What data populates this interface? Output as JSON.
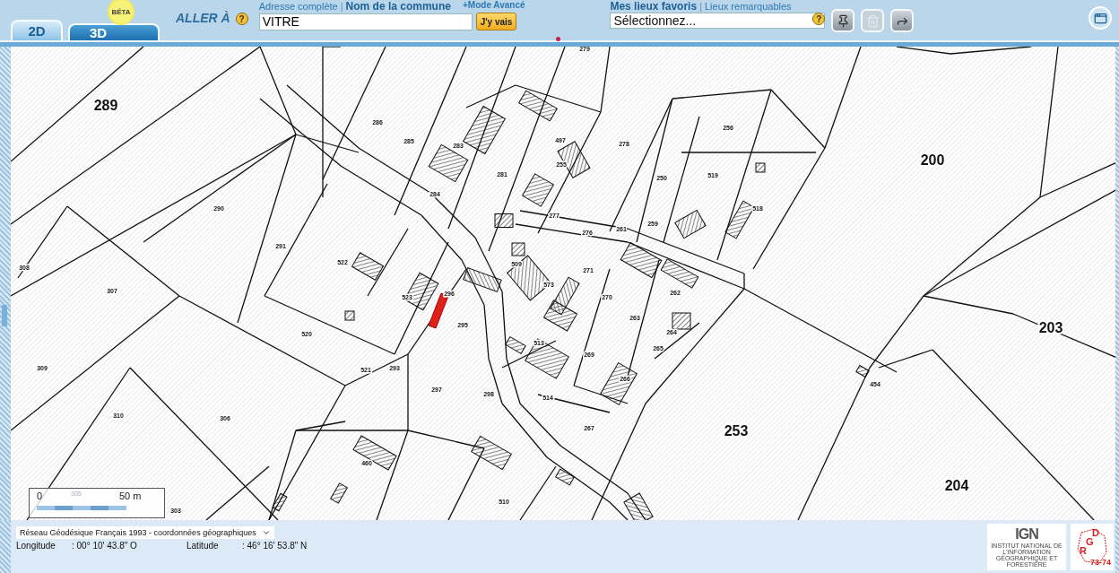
{
  "tabs": [
    {
      "label": "2D",
      "selected": true
    },
    {
      "label": "3D",
      "selected": false
    }
  ],
  "beta_badge": "BÉTA",
  "goto": {
    "label": "ALLER À",
    "help": "?",
    "separator": "|",
    "links": [
      {
        "label": "Adresse complète",
        "selected": false
      },
      {
        "label": "Nom de la commune",
        "selected": true
      }
    ],
    "value": "VITRE",
    "button": "J'y vais",
    "advanced": "+Mode Avancé"
  },
  "favorites": {
    "separator": "|",
    "links": [
      {
        "label": "Mes lieux favoris",
        "selected": true
      },
      {
        "label": "Lieux remarquables",
        "selected": false
      }
    ],
    "help": "?",
    "select": "Sélectionnez...",
    "tools": [
      {
        "kind": "pin",
        "disabled": false
      },
      {
        "kind": "trash",
        "disabled": true
      },
      {
        "kind": "pin-arrow",
        "disabled": false
      }
    ]
  },
  "map": {
    "parcels": [
      {
        "label": "279",
        "kind": "small"
      },
      {
        "label": "289",
        "kind": "large"
      },
      {
        "label": "286",
        "kind": "small"
      },
      {
        "label": "285",
        "kind": "small"
      },
      {
        "label": "283",
        "kind": "small"
      },
      {
        "label": "497",
        "kind": "small"
      },
      {
        "label": "278",
        "kind": "small"
      },
      {
        "label": "256",
        "kind": "small"
      },
      {
        "label": "200",
        "kind": "large"
      },
      {
        "label": "281",
        "kind": "small"
      },
      {
        "label": "255",
        "kind": "small"
      },
      {
        "label": "284",
        "kind": "small"
      },
      {
        "label": "290",
        "kind": "small"
      },
      {
        "label": "250",
        "kind": "small"
      },
      {
        "label": "519",
        "kind": "small"
      },
      {
        "label": "277",
        "kind": "small"
      },
      {
        "label": "518",
        "kind": "small"
      },
      {
        "label": "276",
        "kind": "small"
      },
      {
        "label": "261",
        "kind": "small"
      },
      {
        "label": "259",
        "kind": "small"
      },
      {
        "label": "291",
        "kind": "small"
      },
      {
        "label": "308",
        "kind": "small"
      },
      {
        "label": "522",
        "kind": "small"
      },
      {
        "label": "509",
        "kind": "small"
      },
      {
        "label": "271",
        "kind": "small"
      },
      {
        "label": "307",
        "kind": "small"
      },
      {
        "label": "573",
        "kind": "small"
      },
      {
        "label": "523",
        "kind": "small"
      },
      {
        "label": "296",
        "kind": "small"
      },
      {
        "label": "295",
        "kind": "small"
      },
      {
        "label": "270",
        "kind": "small"
      },
      {
        "label": "262",
        "kind": "small"
      },
      {
        "label": "263",
        "kind": "small"
      },
      {
        "label": "520",
        "kind": "small"
      },
      {
        "label": "264",
        "kind": "small"
      },
      {
        "label": "265",
        "kind": "small"
      },
      {
        "label": "203",
        "kind": "large"
      },
      {
        "label": "309",
        "kind": "small"
      },
      {
        "label": "521",
        "kind": "small"
      },
      {
        "label": "293",
        "kind": "small"
      },
      {
        "label": "513",
        "kind": "small"
      },
      {
        "label": "269",
        "kind": "small"
      },
      {
        "label": "297",
        "kind": "small"
      },
      {
        "label": "298",
        "kind": "small"
      },
      {
        "label": "266",
        "kind": "small"
      },
      {
        "label": "514",
        "kind": "small"
      },
      {
        "label": "454",
        "kind": "small"
      },
      {
        "label": "310",
        "kind": "small"
      },
      {
        "label": "306",
        "kind": "small"
      },
      {
        "label": "267",
        "kind": "small"
      },
      {
        "label": "253",
        "kind": "large"
      },
      {
        "label": "460",
        "kind": "small"
      },
      {
        "label": "204",
        "kind": "large"
      },
      {
        "label": "510",
        "kind": "small"
      },
      {
        "label": "303",
        "kind": "small"
      }
    ],
    "scale": {
      "start": "0",
      "middle": "305",
      "end": "50 m"
    }
  },
  "footer": {
    "projection": "Réseau Géodésique Français 1993 - coordonnées géographiques",
    "longitude_label": "Longitude",
    "longitude": ": 00° 10' 43.8\" O",
    "latitude_label": "Latitude",
    "latitude": ": 46° 16' 53.8\" N",
    "ign_logo": {
      "mark": "IGN",
      "caption": "INSTITUT NATIONAL DE L'INFORMATION GÉOGRAPHIQUE ET FORESTIÈRE"
    },
    "dgr_logo": {
      "letters": [
        "D",
        "G",
        "R"
      ],
      "caption": "73-74"
    }
  }
}
